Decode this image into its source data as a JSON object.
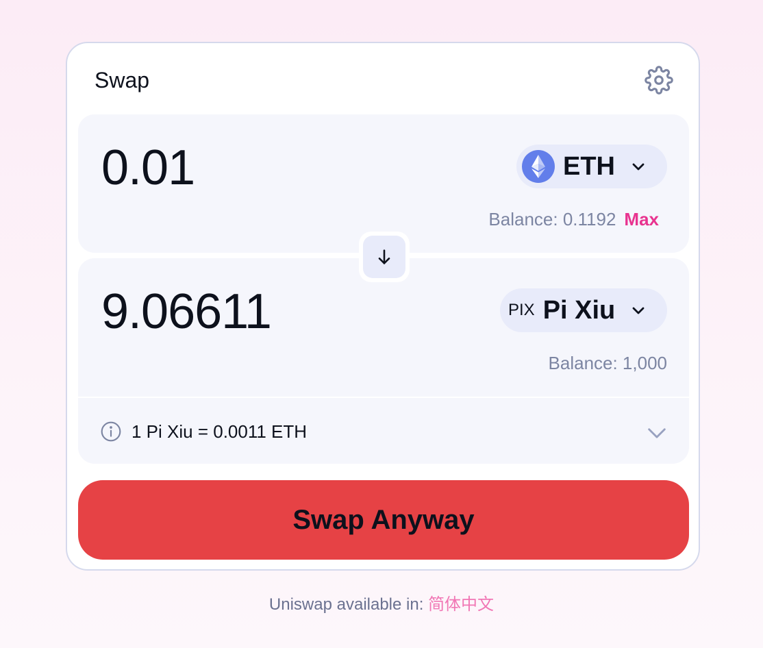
{
  "header": {
    "title": "Swap",
    "settings_icon": "gear-icon"
  },
  "input": {
    "amount": "0.01",
    "token_symbol": "ETH",
    "token_icon": "ethereum-logo-icon",
    "balance": "Balance: 0.1192",
    "max_label": "Max"
  },
  "switch": {
    "icon": "arrow-down-icon"
  },
  "output": {
    "amount": "9.06611",
    "token_ticker": "PIX",
    "token_name": "Pi Xiu",
    "balance": "Balance: 1,000"
  },
  "rate": {
    "icon": "info-icon",
    "text": "1 Pi Xiu = 0.0011 ETH",
    "expand_icon": "chevron-down-icon"
  },
  "action": {
    "label": "Swap Anyway",
    "color": "#e64245"
  },
  "footer": {
    "text": "Uniswap available in:",
    "language_link": "简体中文"
  },
  "colors": {
    "accent_pink": "#e8338f",
    "panel_bg": "#f5f6fc",
    "pill_bg": "#e8ebfa",
    "muted_text": "#7c85a2"
  }
}
